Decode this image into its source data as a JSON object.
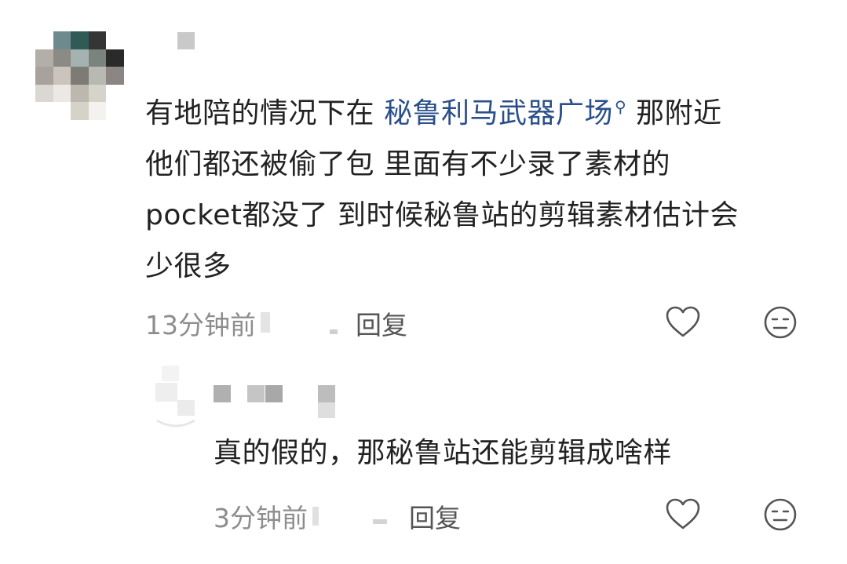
{
  "comments": [
    {
      "text_before": "有地陪的情况下在 ",
      "topic": "秘鲁利马武器广场",
      "text_after_line1": "那附近",
      "line2": "他们都还被偷了包 里面有不少录了素材的",
      "line3": "pocket都没了 到时候秘鲁站的剪辑素材估计会",
      "line4": "少很多",
      "timestamp": "13分钟前",
      "reply_label": "回复"
    },
    {
      "text": "真的假的，那秘鲁站还能剪辑成啥样",
      "timestamp": "3分钟前",
      "reply_label": "回复"
    }
  ],
  "icons": {
    "like": "heart-outline-icon",
    "reaction": "neutral-face-icon",
    "topic_search": "search-icon"
  },
  "colors": {
    "topic_link": "#2b4f8a",
    "meta_gray": "#8d8d8d",
    "text": "#222222"
  }
}
